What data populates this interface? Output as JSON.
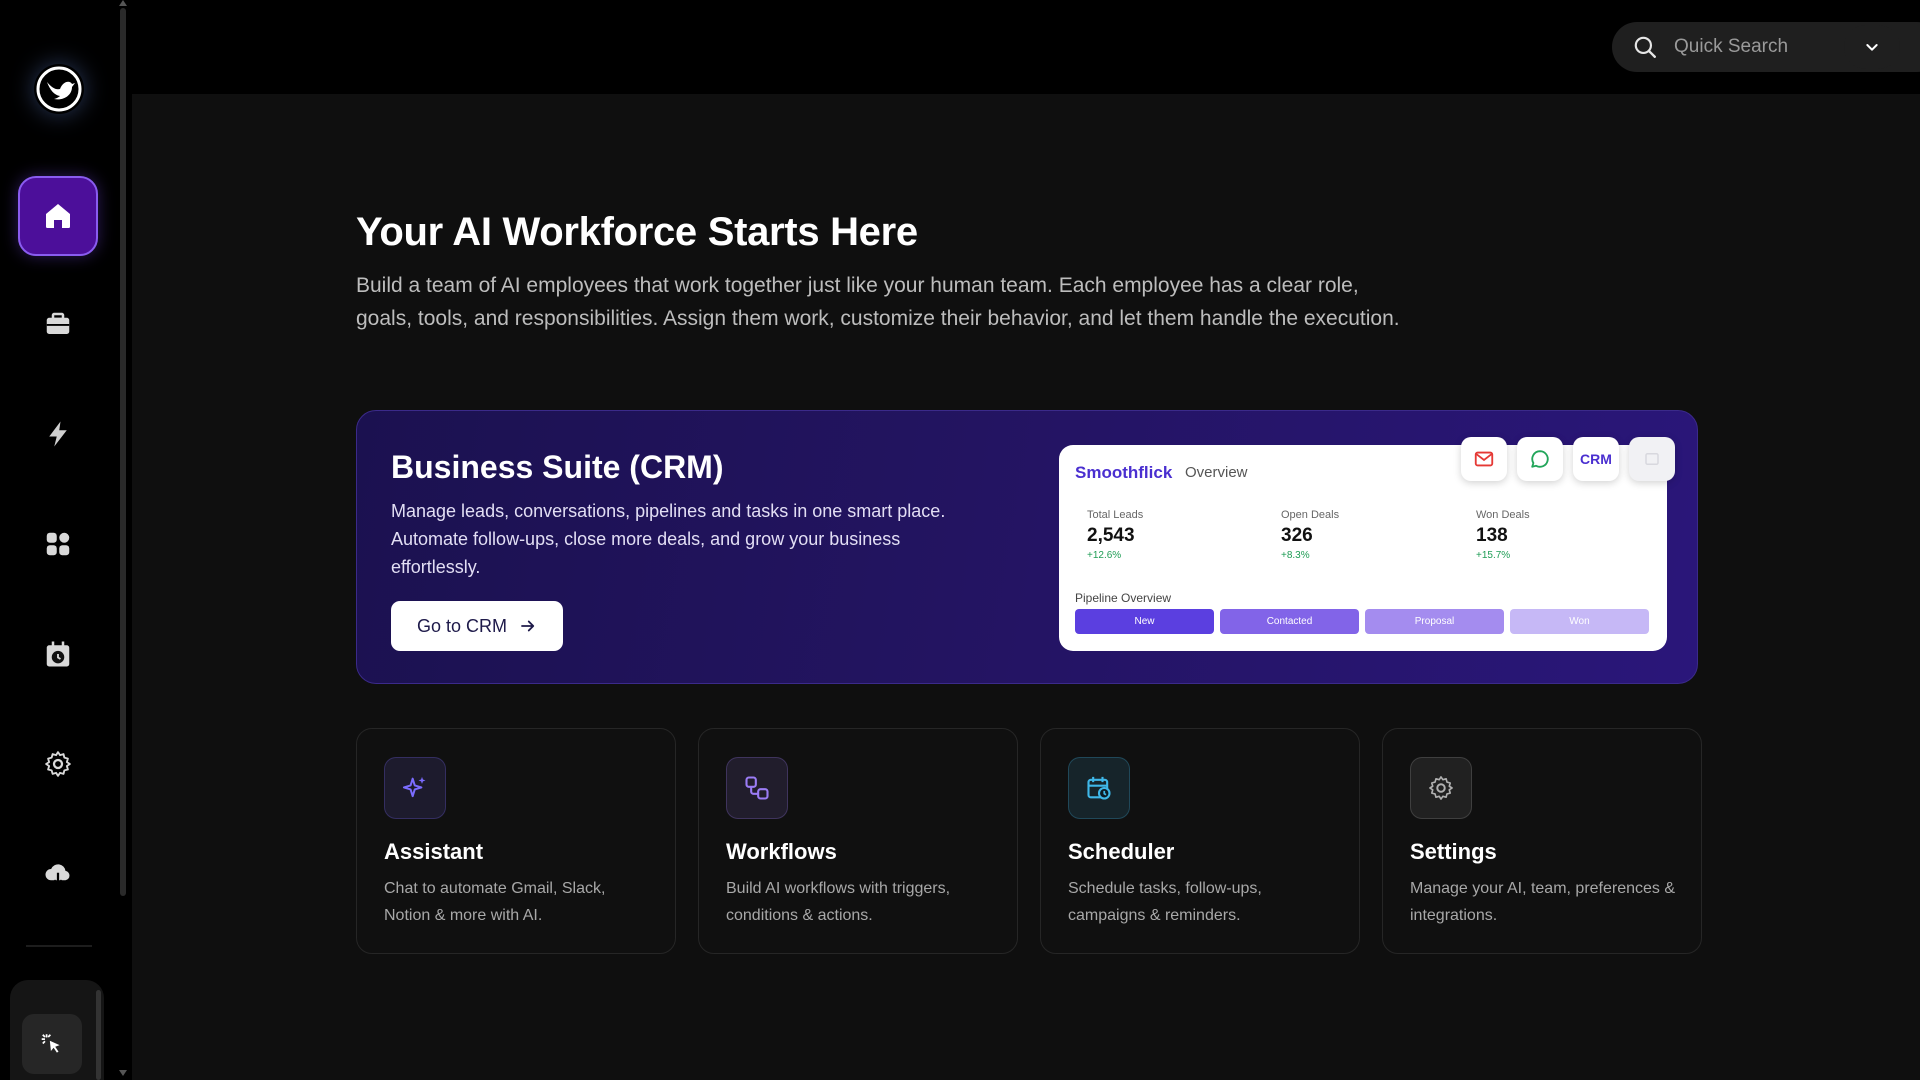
{
  "search": {
    "placeholder": "Quick Search"
  },
  "header": {
    "title": "Your AI Workforce Starts Here",
    "description": "Build a team of AI employees that work together just like your human team. Each employee has a clear role, goals, tools, and responsibilities. Assign them work, customize their behavior, and let them handle the execution."
  },
  "sidebar": {
    "items": [
      {
        "icon": "home-icon",
        "active": true
      },
      {
        "icon": "briefcase-icon"
      },
      {
        "icon": "lightning-icon"
      },
      {
        "icon": "apps-grid-icon"
      },
      {
        "icon": "calendar-clock-icon"
      },
      {
        "icon": "gear-icon"
      },
      {
        "icon": "cloud-download-icon"
      }
    ]
  },
  "crm": {
    "title": "Business Suite (CRM)",
    "description": "Manage leads, conversations, pipelines and tasks in one smart place. Automate follow-ups, close more deals, and grow your business effortlessly.",
    "button_label": "Go to CRM",
    "preview": {
      "brand": "Smoothflick",
      "tab": "Overview",
      "icon_label_crm": "CRM",
      "stats": [
        {
          "label": "Total Leads",
          "value": "2,543",
          "delta": "+12.6%"
        },
        {
          "label": "Open Deals",
          "value": "326",
          "delta": "+8.3%"
        },
        {
          "label": "Won Deals",
          "value": "138",
          "delta": "+15.7%"
        }
      ],
      "pipeline_label": "Pipeline Overview",
      "pipeline_stages": [
        {
          "label": "New",
          "color": "#5b3fe0"
        },
        {
          "label": "Contacted",
          "color": "#8264e8"
        },
        {
          "label": "Proposal",
          "color": "#a48cef"
        },
        {
          "label": "Won",
          "color": "#c6b8f6"
        }
      ]
    }
  },
  "cards": [
    {
      "title": "Assistant",
      "description": "Chat to automate Gmail, Slack, Notion & more with AI.",
      "icon": "sparkle-icon",
      "accent": "#7b6cff"
    },
    {
      "title": "Workflows",
      "description": "Build AI workflows with triggers, conditions & actions.",
      "icon": "workflow-icon",
      "accent": "#9b7cf5"
    },
    {
      "title": "Scheduler",
      "description": "Schedule tasks, follow-ups, campaigns & reminders.",
      "icon": "calendar-clock-icon",
      "accent": "#3fb7e8"
    },
    {
      "title": "Settings",
      "description": "Manage your AI, team, preferences & integrations.",
      "icon": "gear-icon",
      "accent": "#9a9a9a"
    }
  ]
}
